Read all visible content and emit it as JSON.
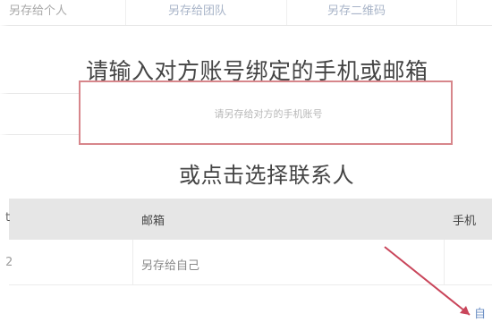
{
  "tabs": [
    {
      "label": "另存给个人"
    },
    {
      "label": "另存给团队"
    },
    {
      "label": "另存二维码"
    }
  ],
  "prompt": "请输入对方账号绑定的手机或邮箱",
  "input": {
    "placeholder": "请另存给对方的手机账号",
    "value": ""
  },
  "contacts_heading": "或点击选择联系人",
  "table": {
    "columns": [
      "t",
      "邮箱",
      "手机"
    ],
    "rows": [
      [
        "2",
        "另存给自己",
        ""
      ]
    ]
  },
  "corner_button": "自",
  "colors": {
    "input_border": "#d7868b",
    "header_bg": "#e6e6e6",
    "arrow": "#c9455a"
  }
}
